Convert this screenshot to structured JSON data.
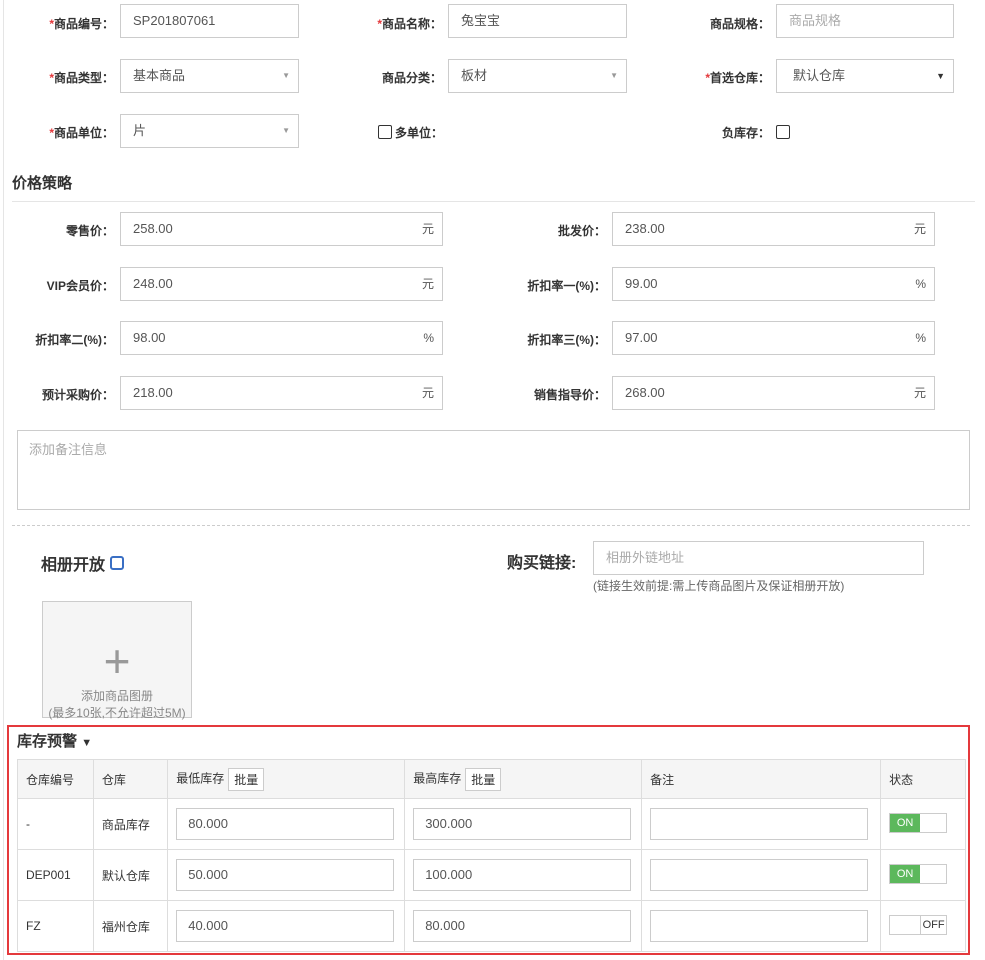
{
  "basic": {
    "code_label": "商品编号：",
    "code_value": "SP201807061",
    "name_label": "商品名称：",
    "name_value": "兔宝宝",
    "spec_label": "商品规格：",
    "spec_placeholder": "商品规格",
    "type_label": "商品类型：",
    "type_value": "基本商品",
    "category_label": "商品分类：",
    "category_value": "板材",
    "warehouse_label": "首选仓库：",
    "warehouse_value": "默认仓库",
    "unit_label": "商品单位：",
    "unit_value": "片",
    "multi_unit_label": "多单位：",
    "negative_stock_label": "负库存："
  },
  "pricing": {
    "title": "价格策略",
    "retail_label": "零售价：",
    "retail_value": "258.00",
    "retail_unit": "元",
    "wholesale_label": "批发价：",
    "wholesale_value": "238.00",
    "wholesale_unit": "元",
    "vip_label": "VIP会员价：",
    "vip_value": "248.00",
    "vip_unit": "元",
    "disc1_label": "折扣率一(%)：",
    "disc1_value": "99.00",
    "disc1_unit": "%",
    "disc2_label": "折扣率二(%)：",
    "disc2_value": "98.00",
    "disc2_unit": "%",
    "disc3_label": "折扣率三(%)：",
    "disc3_value": "97.00",
    "disc3_unit": "%",
    "purchase_label": "预计采购价：",
    "purchase_value": "218.00",
    "purchase_unit": "元",
    "guide_label": "销售指导价：",
    "guide_value": "268.00",
    "guide_unit": "元",
    "remark_placeholder": "添加备注信息"
  },
  "album": {
    "open_label": "相册开放",
    "buy_link_label": "购买链接:",
    "buy_link_placeholder": "相册外链地址",
    "buy_link_hint": "(链接生效前提:需上传商品图片及保证相册开放)",
    "upload_plus": "+",
    "upload_line1": "添加商品图册",
    "upload_line2": "(最多10张,不允许超过5M)"
  },
  "stock_warning": {
    "title": "库存预警",
    "highlight_color": "#e4393c",
    "headers": {
      "code": "仓库编号",
      "warehouse": "仓库",
      "min": "最低库存",
      "max": "最高库存",
      "batch": "批量",
      "remark": "备注",
      "status": "状态"
    },
    "rows": [
      {
        "code": "-",
        "warehouse": "商品库存",
        "min": "80.000",
        "max": "300.000",
        "remark": "",
        "status": "ON"
      },
      {
        "code": "DEP001",
        "warehouse": "默认仓库",
        "min": "50.000",
        "max": "100.000",
        "remark": "",
        "status": "ON"
      },
      {
        "code": "FZ",
        "warehouse": "福州仓库",
        "min": "40.000",
        "max": "80.000",
        "remark": "",
        "status": "OFF"
      }
    ]
  }
}
